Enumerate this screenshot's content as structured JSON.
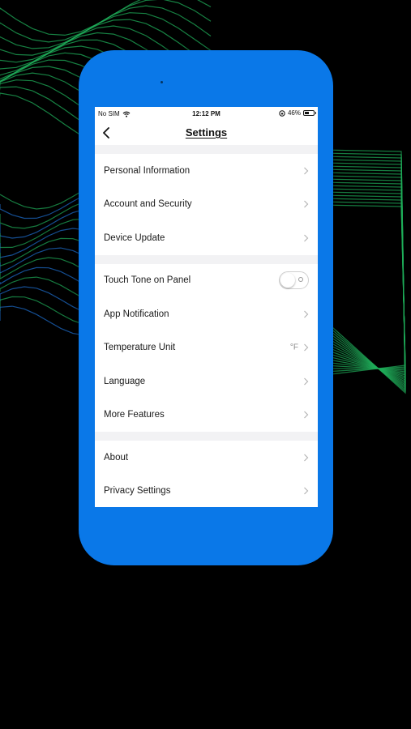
{
  "status_bar": {
    "carrier": "No SIM",
    "time": "12:12 PM",
    "battery_percent": "46%",
    "battery_level": 0.46,
    "icons": [
      "wifi-icon",
      "orientation-lock-icon",
      "battery-icon"
    ]
  },
  "header": {
    "title": "Settings",
    "back_icon": "chevron-left-icon"
  },
  "sections": [
    {
      "items": [
        {
          "label": "Personal Information",
          "accessory": "chevron"
        },
        {
          "label": "Account and Security",
          "accessory": "chevron"
        },
        {
          "label": "Device Update",
          "accessory": "chevron"
        }
      ]
    },
    {
      "items": [
        {
          "label": "Touch Tone on Panel",
          "accessory": "toggle",
          "toggle_on": false
        },
        {
          "label": "App Notification",
          "accessory": "chevron"
        },
        {
          "label": "Temperature Unit",
          "accessory": "chevron",
          "value": "°F"
        },
        {
          "label": "Language",
          "accessory": "chevron"
        },
        {
          "label": "More Features",
          "accessory": "chevron"
        }
      ]
    },
    {
      "items": [
        {
          "label": "About",
          "accessory": "chevron"
        },
        {
          "label": "Privacy Settings",
          "accessory": "chevron"
        }
      ]
    }
  ],
  "colors": {
    "phone_frame": "#0a78e8",
    "background": "#000000",
    "wave_green": "#1fae5a",
    "wave_blue": "#1e6fd0",
    "section_gap": "#f2f2f4"
  }
}
